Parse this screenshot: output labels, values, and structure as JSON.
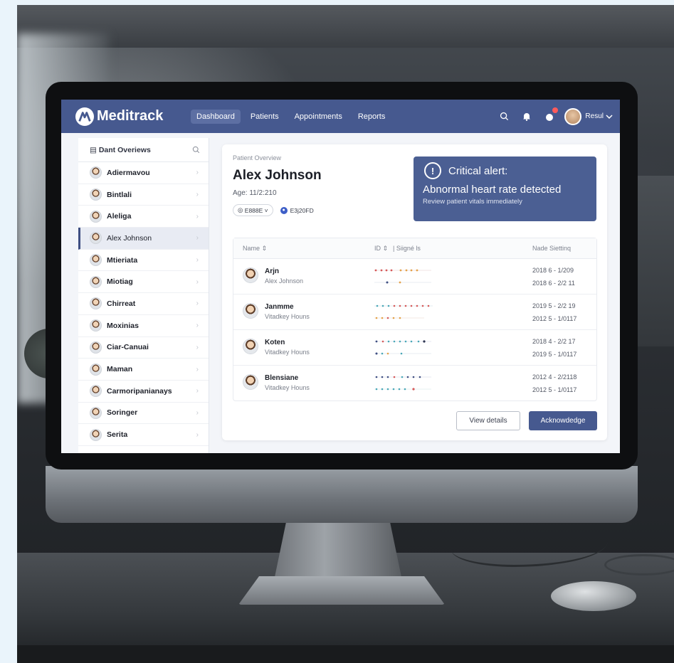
{
  "app": {
    "name": "Meditrack"
  },
  "nav": {
    "tabs": [
      {
        "label": "Dashboard",
        "active": true
      },
      {
        "label": "Patients",
        "active": false
      },
      {
        "label": "Appointments",
        "active": false
      },
      {
        "label": "Reports",
        "active": false
      }
    ],
    "user_name": "Resul",
    "icons": [
      "search-icon",
      "bell-icon",
      "notification-icon",
      "user-avatar",
      "chevron-down-icon"
    ]
  },
  "sidebar": {
    "title": "Dant Overiews",
    "items": [
      {
        "label": "Adiermavou"
      },
      {
        "label": "Bintlali"
      },
      {
        "label": "Aleliga"
      },
      {
        "label": "Alex Johnson",
        "active": true
      },
      {
        "label": "Mtieriata"
      },
      {
        "label": "Miotiag"
      },
      {
        "label": "Chirreat"
      },
      {
        "label": "Moxinias"
      },
      {
        "label": "Ciar-Canuai"
      },
      {
        "label": "Maman"
      },
      {
        "label": "Carmoripanianays"
      },
      {
        "label": "Soringer"
      },
      {
        "label": "Serita"
      }
    ]
  },
  "overview": {
    "label": "Patient Overview",
    "name": "Alex Johnson",
    "age": "Age: 11/2:210",
    "chip1": "E888E",
    "chip2": "E3j20FD"
  },
  "alert": {
    "title": "Critical alert:",
    "message": "Abnormal heart rate detected",
    "sub": "Review patient vitals immediately",
    "color": "#4b5f93"
  },
  "table": {
    "headers": [
      "Name",
      "ID",
      "Siigné ls",
      "Nade Siettinq"
    ],
    "rows": [
      {
        "name": "Arjn",
        "sub": "Alex Johnson",
        "date1": "2018 6 - 1/209",
        "date2": "2018 6 - 2/2 11"
      },
      {
        "name": "Janmme",
        "sub": "Vitadkey Houns",
        "date1": "2019 5 - 2/2 19",
        "date2": "2012 5 - 1/0117"
      },
      {
        "name": "Koten",
        "sub": "Vitadkey Houns",
        "date1": "2018 4 - 2/2 17",
        "date2": "2019 5 - 1/0117"
      },
      {
        "name": "Blensiane",
        "sub": "Vitadkey Houns",
        "date1": "2012 4 - 2/2118",
        "date2": "2012 5 - 1/0117"
      }
    ]
  },
  "buttons": {
    "view": "View details",
    "ack": "Acknowdedge"
  },
  "colors": {
    "nav": "#46598f",
    "accent": "#3f4f82"
  }
}
